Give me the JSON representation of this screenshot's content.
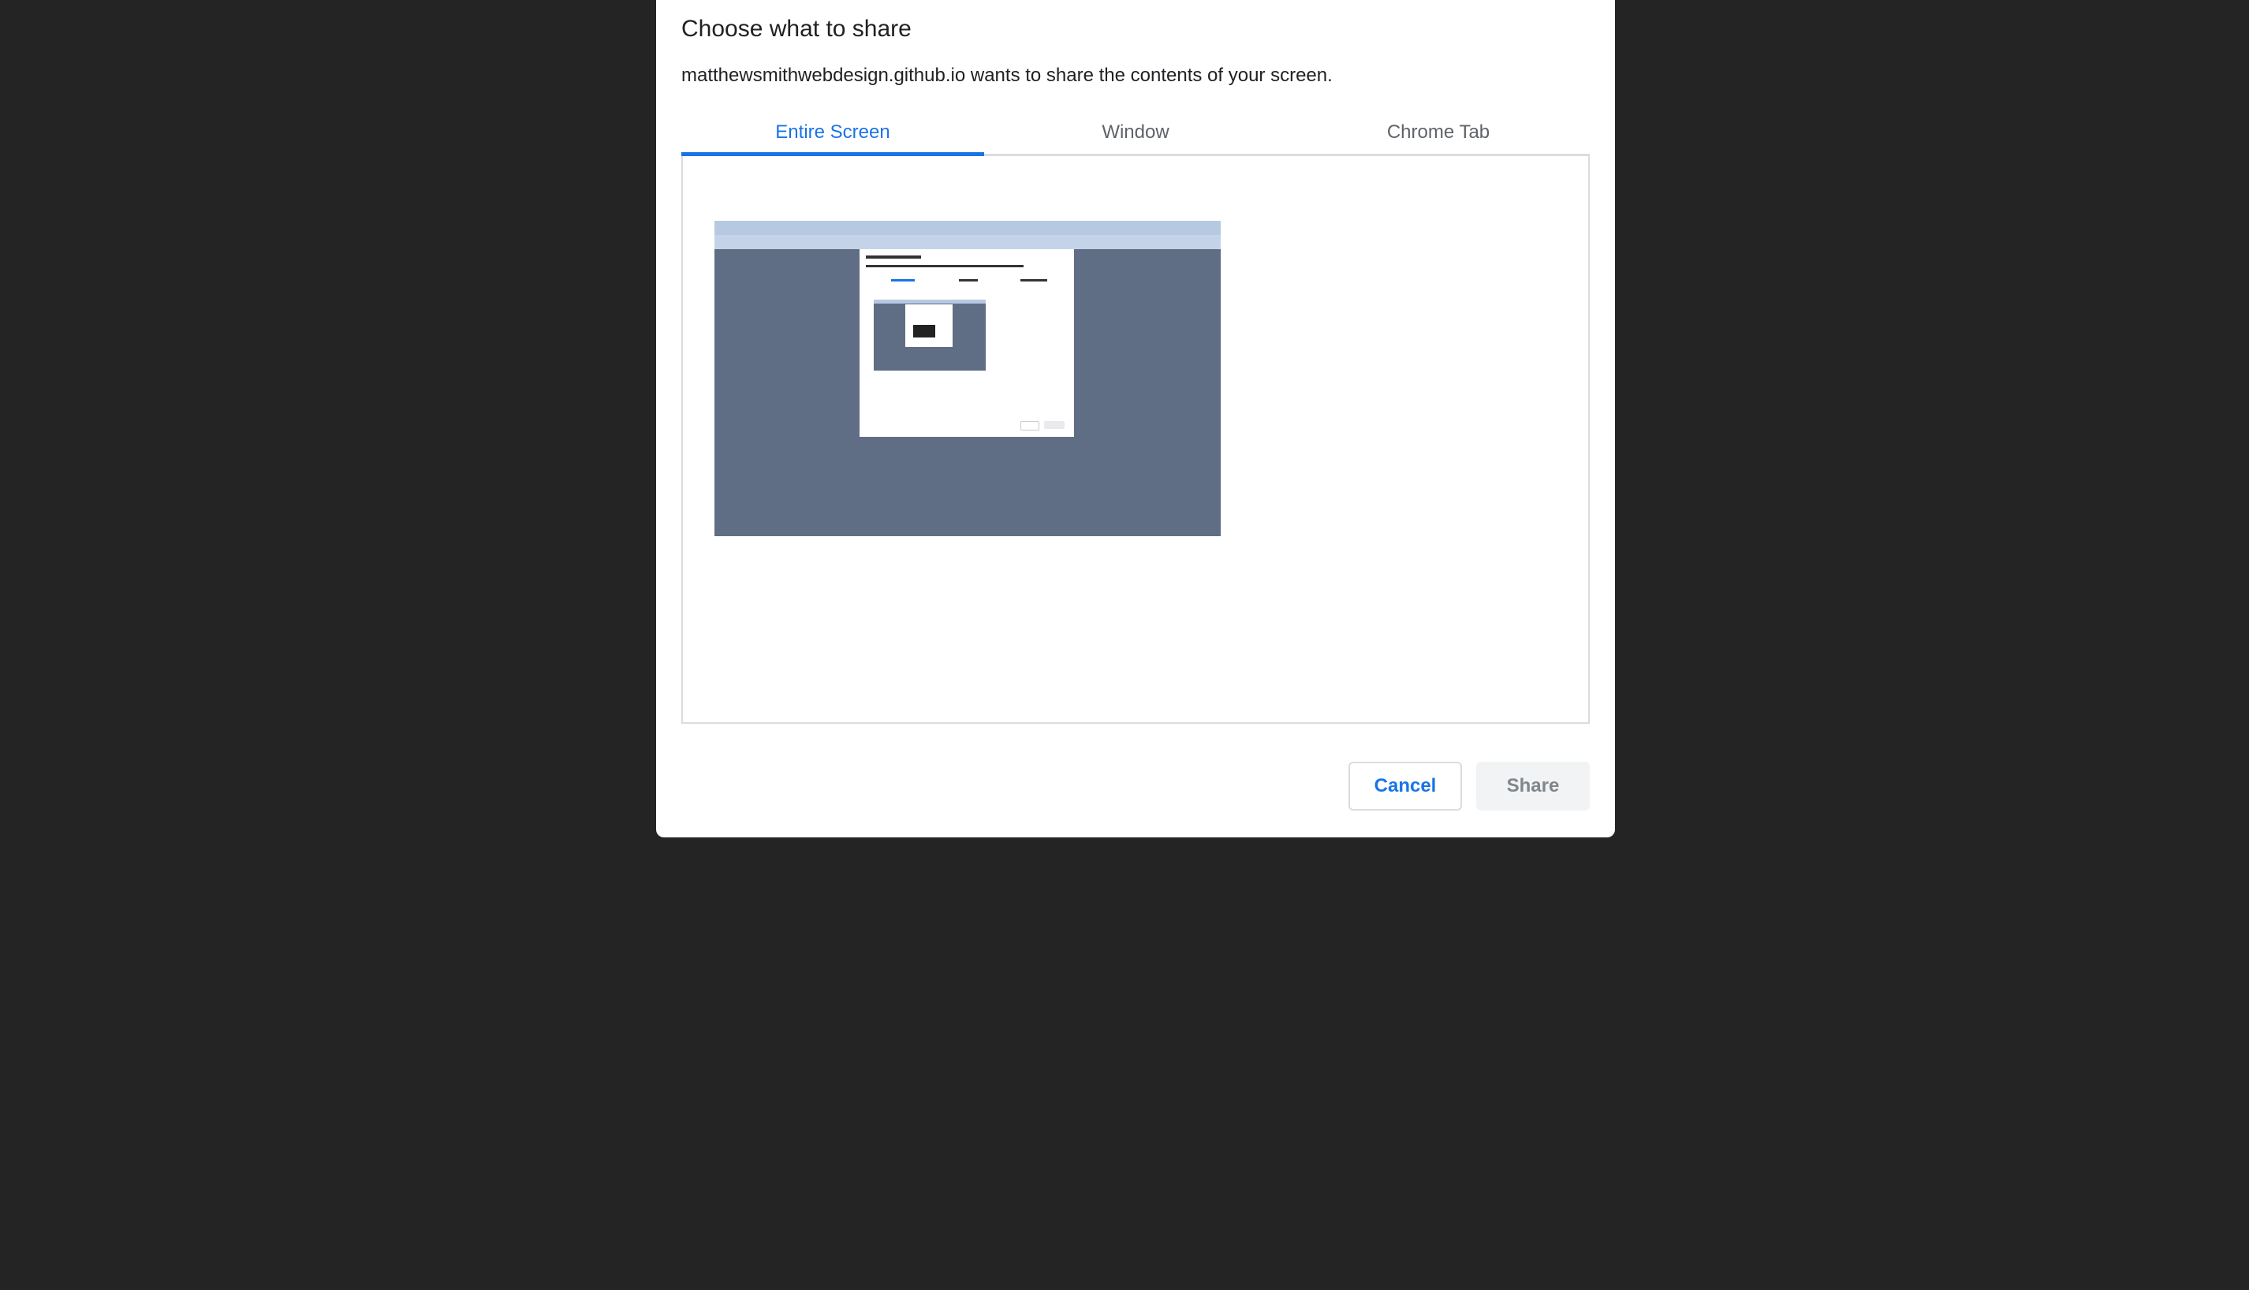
{
  "dialog": {
    "title": "Choose what to share",
    "subtitle": "matthewsmithwebdesign.github.io wants to share the contents of your screen."
  },
  "tabs": [
    {
      "label": "Entire Screen",
      "active": true
    },
    {
      "label": "Window",
      "active": false
    },
    {
      "label": "Chrome Tab",
      "active": false
    }
  ],
  "preview": {
    "type": "screen-thumbnail",
    "selected": false
  },
  "buttons": {
    "cancel_label": "Cancel",
    "share_label": "Share",
    "share_enabled": false
  },
  "colors": {
    "accent": "#1a73e8",
    "backdrop": "#242424",
    "dialog_bg": "#ffffff",
    "disabled_text": "#80868b"
  }
}
